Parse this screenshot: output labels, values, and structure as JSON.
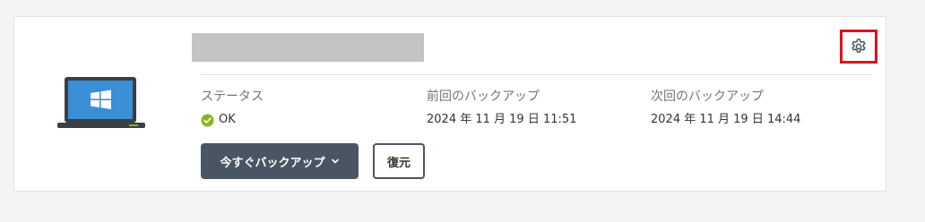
{
  "device": {
    "icon": "windows-laptop-icon"
  },
  "settings": {
    "icon": "gear-icon",
    "highlight_color": "#e0101a"
  },
  "status": {
    "label": "ステータス",
    "value": "OK",
    "icon": "check-circle-icon",
    "color": "#8ab31f"
  },
  "last_backup": {
    "label": "前回のバックアップ",
    "value": "2024 年 11 月 19 日 11:51"
  },
  "next_backup": {
    "label": "次回のバックアップ",
    "value": "2024 年 11 月 19 日 14:44"
  },
  "actions": {
    "backup_now_label": "今すぐバックアップ",
    "backup_now_icon": "chevron-down-icon",
    "restore_label": "復元"
  },
  "colors": {
    "primary_button": "#4a5563",
    "background": "#f4f4f4"
  }
}
